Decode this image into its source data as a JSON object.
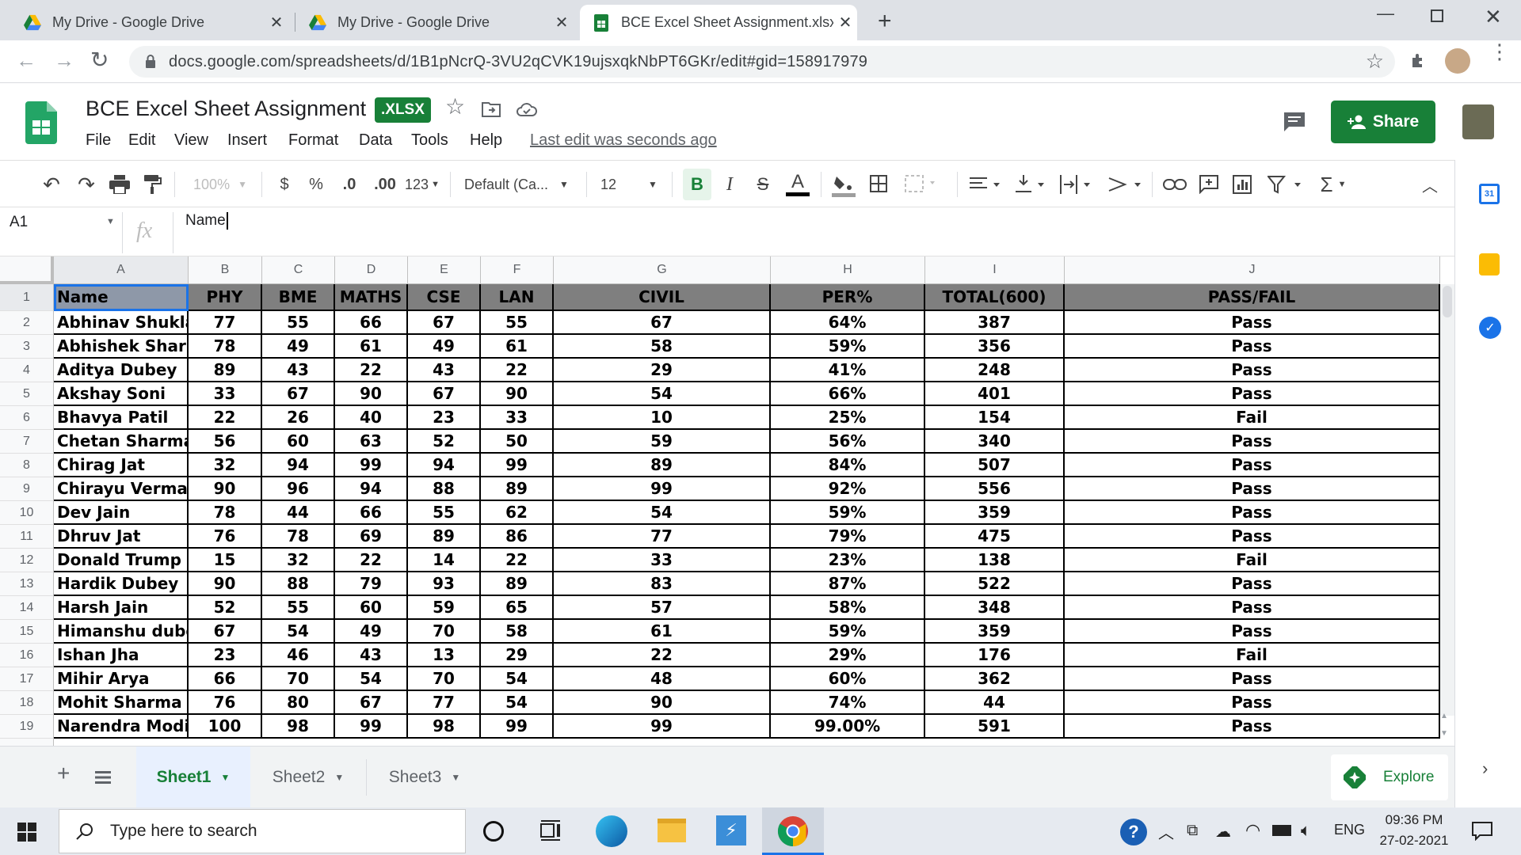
{
  "browser": {
    "tabs": [
      {
        "title": "My Drive - Google Drive",
        "active": false
      },
      {
        "title": "My Drive - Google Drive",
        "active": false
      },
      {
        "title": "BCE Excel Sheet Assignment.xlsx",
        "active": true
      }
    ],
    "url": "docs.google.com/spreadsheets/d/1B1pNcrQ-3VU2qCVK19ujsxqkNbPT6GKr/edit#gid=158917979"
  },
  "doc": {
    "title": "BCE Excel Sheet Assignment",
    "badge": ".XLSX",
    "menu": [
      "File",
      "Edit",
      "View",
      "Insert",
      "Format",
      "Data",
      "Tools",
      "Help"
    ],
    "last_edit": "Last edit was seconds ago",
    "share_label": "Share"
  },
  "toolbar": {
    "zoom": "100%",
    "currency": "$",
    "percent": "%",
    "dec_decrease": ".0",
    "dec_increase": ".00",
    "more_formats": "123",
    "font": "Default (Ca...",
    "font_size": "12",
    "bold": "B",
    "italic": "I",
    "strike": "S",
    "text_color": "A"
  },
  "formula_bar": {
    "cell_ref": "A1",
    "fx": "fx",
    "value": "Name"
  },
  "grid": {
    "columns": [
      "A",
      "B",
      "C",
      "D",
      "E",
      "F",
      "G",
      "H",
      "I",
      "J"
    ],
    "header": [
      "Name",
      "PHY",
      "BME",
      "MATHS",
      "CSE",
      "LAN",
      "CIVIL",
      "PER%",
      "TOTAL(600)",
      "PASS/FAIL"
    ],
    "rows": [
      [
        "Abhinav Shukla",
        "77",
        "55",
        "66",
        "67",
        "55",
        "67",
        "64%",
        "387",
        "Pass"
      ],
      [
        "Abhishek Sharma",
        "78",
        "49",
        "61",
        "49",
        "61",
        "58",
        "59%",
        "356",
        "Pass"
      ],
      [
        "Aditya Dubey",
        "89",
        "43",
        "22",
        "43",
        "22",
        "29",
        "41%",
        "248",
        "Pass"
      ],
      [
        "Akshay Soni",
        "33",
        "67",
        "90",
        "67",
        "90",
        "54",
        "66%",
        "401",
        "Pass"
      ],
      [
        "Bhavya Patil",
        "22",
        "26",
        "40",
        "23",
        "33",
        "10",
        "25%",
        "154",
        "Fail"
      ],
      [
        "Chetan Sharma",
        "56",
        "60",
        "63",
        "52",
        "50",
        "59",
        "56%",
        "340",
        "Pass"
      ],
      [
        "Chirag Jat",
        "32",
        "94",
        "99",
        "94",
        "99",
        "89",
        "84%",
        "507",
        "Pass"
      ],
      [
        "Chirayu Verma",
        "90",
        "96",
        "94",
        "88",
        "89",
        "99",
        "92%",
        "556",
        "Pass"
      ],
      [
        "Dev Jain",
        "78",
        "44",
        "66",
        "55",
        "62",
        "54",
        "59%",
        "359",
        "Pass"
      ],
      [
        "Dhruv Jat",
        "76",
        "78",
        "69",
        "89",
        "86",
        "77",
        "79%",
        "475",
        "Pass"
      ],
      [
        "Donald Trump",
        "15",
        "32",
        "22",
        "14",
        "22",
        "33",
        "23%",
        "138",
        "Fail"
      ],
      [
        "Hardik Dubey",
        "90",
        "88",
        "79",
        "93",
        "89",
        "83",
        "87%",
        "522",
        "Pass"
      ],
      [
        "Harsh Jain",
        "52",
        "55",
        "60",
        "59",
        "65",
        "57",
        "58%",
        "348",
        "Pass"
      ],
      [
        "Himanshu dubey",
        "67",
        "54",
        "49",
        "70",
        "58",
        "61",
        "59%",
        "359",
        "Pass"
      ],
      [
        "Ishan Jha",
        "23",
        "46",
        "43",
        "13",
        "29",
        "22",
        "29%",
        "176",
        "Fail"
      ],
      [
        "Mihir Arya",
        "66",
        "70",
        "54",
        "70",
        "54",
        "48",
        "60%",
        "362",
        "Pass"
      ],
      [
        "Mohit Sharma",
        "76",
        "80",
        "67",
        "77",
        "54",
        "90",
        "74%",
        "44",
        "Pass"
      ],
      [
        "Narendra Modi",
        "100",
        "98",
        "99",
        "98",
        "99",
        "99",
        "99.00%",
        "591",
        "Pass"
      ]
    ]
  },
  "sheets": {
    "tabs": [
      "Sheet1",
      "Sheet2",
      "Sheet3"
    ],
    "explore": "Explore"
  },
  "taskbar": {
    "search_placeholder": "Type here to search",
    "lang": "ENG",
    "time": "09:36 PM",
    "date": "27-02-2021"
  },
  "colors": {
    "sheets_green": "#188038",
    "header_fill": "#7f7f7f",
    "selection_blue": "#1a73e8"
  }
}
